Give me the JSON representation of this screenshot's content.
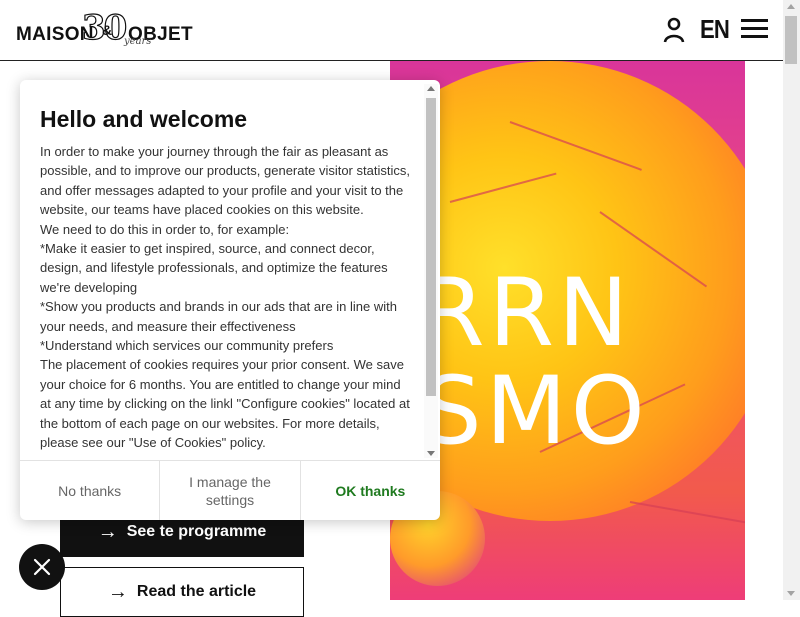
{
  "header": {
    "logo_left": "MAISON",
    "logo_thirty": "30",
    "logo_amp": "&",
    "logo_right": "OBJET",
    "logo_years": "years",
    "lang": "EN",
    "icons": {
      "user": "user-icon",
      "menu": "hamburger-menu-icon"
    }
  },
  "hero": {
    "line1": "ERRN",
    "line2": "OSMO"
  },
  "page": {
    "programme_button": "See te programme",
    "article_button": "Read the article",
    "arrow": "→",
    "close_symbol": "✕"
  },
  "cookie_modal": {
    "title": "Hello and welcome",
    "paragraphs": [
      "In order to make your journey through the fair as pleasant as possible, and to improve our products, generate visitor statistics, and offer messages adapted to your profile and your visit to the website, our teams have placed cookies on this website.",
      "We need to do this in order to, for example:",
      "*Make it easier to get inspired, source, and connect decor, design, and lifestyle professionals, and optimize the features we're developing",
      "*Show you products and brands in our ads that are in line with your needs, and measure their effectiveness",
      "*Understand which services our community prefers",
      "The placement of cookies requires your prior consent. We save your choice for 6 months. You are entitled to change your mind at any time by clicking on the linkl \"Configure cookies\" located at the bottom of each page on our websites. For more details, please see our \"Use of Cookies\" policy."
    ],
    "buttons": {
      "no_thanks": "No thanks",
      "manage": "I manage the settings",
      "ok": "OK thanks"
    }
  },
  "colors": {
    "accent_ok": "#1f7a1f",
    "dark": "#111111",
    "hero_pink": "#e23f8c",
    "hero_yellow": "#ffc415"
  }
}
